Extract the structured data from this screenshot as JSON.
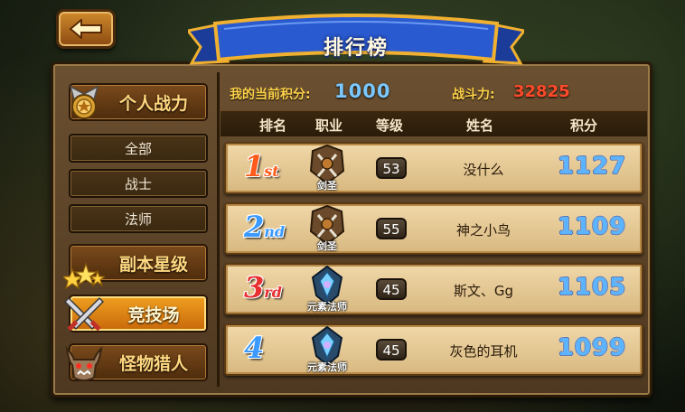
{
  "title": "排行榜",
  "back_button": {
    "icon": "back-arrow-icon"
  },
  "info": {
    "my_score_label": "我的当前积分:",
    "my_score_value": "1000",
    "power_label": "战斗力:",
    "power_value": "32825"
  },
  "sidebar": {
    "personal": {
      "label": "个人战力",
      "icon": "medal-icon"
    },
    "sub_items": [
      {
        "label": "全部"
      },
      {
        "label": "战士"
      },
      {
        "label": "法师"
      }
    ],
    "dungeon": {
      "label": "副本星级",
      "icon": "stars-icon"
    },
    "arena": {
      "label": "竞技场",
      "icon": "crossed-swords-icon"
    },
    "hunter": {
      "label": "怪物猎人",
      "icon": "monster-head-icon"
    }
  },
  "table": {
    "headers": {
      "rank": "排名",
      "job": "职业",
      "level": "等级",
      "name": "姓名",
      "score": "积分"
    },
    "rows": [
      {
        "rank": "1",
        "suffix": "st",
        "job": "剑圣",
        "level": "53",
        "name": "没什么",
        "score": "1127",
        "rank_color": "#ff5a1a"
      },
      {
        "rank": "2",
        "suffix": "nd",
        "job": "剑圣",
        "level": "55",
        "name": "神之小鸟",
        "score": "1109",
        "rank_color": "#3a9aff"
      },
      {
        "rank": "3",
        "suffix": "rd",
        "job": "元素法师",
        "level": "45",
        "name": "斯文、Gg",
        "score": "1105",
        "rank_color": "#e83030"
      },
      {
        "rank": "4",
        "suffix": "",
        "job": "元素法师",
        "level": "45",
        "name": "灰色的耳机",
        "score": "1099",
        "rank_color": "#3a9aff"
      }
    ]
  },
  "colors": {
    "accent": "#f0a020",
    "score_blue": "#5ab4ff",
    "power_red": "#ff4a2a",
    "label_gold": "#ffd24a"
  }
}
